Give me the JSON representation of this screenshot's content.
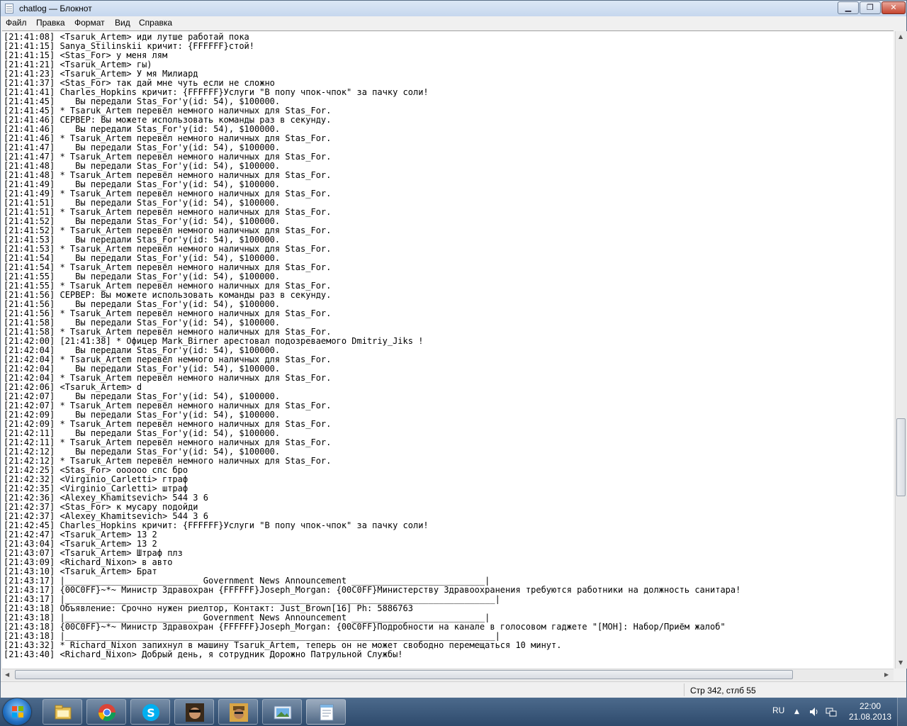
{
  "window": {
    "title": "chatlog — Блокнот",
    "minimize_label": "▁",
    "maximize_label": "❐",
    "close_label": "✕"
  },
  "menu": [
    "Файл",
    "Правка",
    "Формат",
    "Вид",
    "Справка"
  ],
  "lines": [
    "[21:41:08] <Tsaruk_Artem> иди лутше работай пока",
    "[21:41:15] Sanya_Stilinskii кричит: {FFFFFF}стой!",
    "[21:41:15] <Stas_For> у меня лям",
    "[21:41:21] <Tsaruk_Artem> гы)",
    "[21:41:23] <Tsaruk_Artem> У мя Милиард",
    "[21:41:37] <Stas_For> так дай мне чуть если не сложно",
    "[21:41:41] Charles_Hopkins кричит: {FFFFFF}Услуги \"В попу чпок-чпок\" за пачку соли!",
    "[21:41:45]    Вы передали Stas_For'у(id: 54), $100000.",
    "[21:41:45] * Tsaruk_Artem перевёл немного наличных для Stas_For.",
    "[21:41:46] СЕРВЕР: Вы можете использовать команды раз в секунду.",
    "[21:41:46]    Вы передали Stas_For'у(id: 54), $100000.",
    "[21:41:46] * Tsaruk_Artem перевёл немного наличных для Stas_For.",
    "[21:41:47]    Вы передали Stas_For'у(id: 54), $100000.",
    "[21:41:47] * Tsaruk_Artem перевёл немного наличных для Stas_For.",
    "[21:41:48]    Вы передали Stas_For'у(id: 54), $100000.",
    "[21:41:48] * Tsaruk_Artem перевёл немного наличных для Stas_For.",
    "[21:41:49]    Вы передали Stas_For'у(id: 54), $100000.",
    "[21:41:49] * Tsaruk_Artem перевёл немного наличных для Stas_For.",
    "[21:41:51]    Вы передали Stas_For'у(id: 54), $100000.",
    "[21:41:51] * Tsaruk_Artem перевёл немного наличных для Stas_For.",
    "[21:41:52]    Вы передали Stas_For'у(id: 54), $100000.",
    "[21:41:52] * Tsaruk_Artem перевёл немного наличных для Stas_For.",
    "[21:41:53]    Вы передали Stas_For'у(id: 54), $100000.",
    "[21:41:53] * Tsaruk_Artem перевёл немного наличных для Stas_For.",
    "[21:41:54]    Вы передали Stas_For'у(id: 54), $100000.",
    "[21:41:54] * Tsaruk_Artem перевёл немного наличных для Stas_For.",
    "[21:41:55]    Вы передали Stas_For'у(id: 54), $100000.",
    "[21:41:55] * Tsaruk_Artem перевёл немного наличных для Stas_For.",
    "[21:41:56] СЕРВЕР: Вы можете использовать команды раз в секунду.",
    "[21:41:56]    Вы передали Stas_For'у(id: 54), $100000.",
    "[21:41:56] * Tsaruk_Artem перевёл немного наличных для Stas_For.",
    "[21:41:58]    Вы передали Stas_For'у(id: 54), $100000.",
    "[21:41:58] * Tsaruk_Artem перевёл немного наличных для Stas_For.",
    "[21:42:00] [21:41:38] * Офицер Mark_Birner арестовал подозреваемого Dmitriy_Jiks !",
    "[21:42:04]    Вы передали Stas_For'у(id: 54), $100000.",
    "[21:42:04] * Tsaruk_Artem перевёл немного наличных для Stas_For.",
    "[21:42:04]    Вы передали Stas_For'у(id: 54), $100000.",
    "[21:42:04] * Tsaruk_Artem перевёл немного наличных для Stas_For.",
    "[21:42:06] <Tsaruk_Artem> d",
    "[21:42:07]    Вы передали Stas_For'у(id: 54), $100000.",
    "[21:42:07] * Tsaruk_Artem перевёл немного наличных для Stas_For.",
    "[21:42:09]    Вы передали Stas_For'у(id: 54), $100000.",
    "[21:42:09] * Tsaruk_Artem перевёл немного наличных для Stas_For.",
    "[21:42:11]    Вы передали Stas_For'у(id: 54), $100000.",
    "[21:42:11] * Tsaruk_Artem перевёл немного наличных для Stas_For.",
    "[21:42:12]    Вы передали Stas_For'у(id: 54), $100000.",
    "[21:42:12] * Tsaruk_Artem перевёл немного наличных для Stas_For.",
    "[21:42:25] <Stas_For> оооооо спс бро",
    "[21:42:32] <Virginio_Carletti> гтраф",
    "[21:42:35] <Virginio_Carletti> штраф",
    "[21:42:36] <Alexey_Khamitsevich> 544 3 6",
    "[21:42:37] <Stas_For> к мусару подойди",
    "[21:42:37] <Alexey_Khamitsevich> 544 3 6",
    "[21:42:45] Charles_Hopkins кричит: {FFFFFF}Услуги \"В попу чпок-чпок\" за пачку соли!",
    "[21:42:47] <Tsaruk_Artem> 13 2",
    "[21:43:04] <Tsaruk_Artem> 13 2",
    "[21:43:07] <Tsaruk_Artem> Штраф плз",
    "[21:43:09] <Richard_Nixon> в авто",
    "[21:43:10] <Tsaruk_Artem> Брат",
    "[21:43:17] |__________________________ Government News Announcement __________________________|",
    "[21:43:17] {00C0FF}~*~ Министр Здравохран {FFFFFF}Joseph_Morgan: {00C0FF}Министерству Здравоохранения требуются работники на должность санитара!",
    "[21:43:17] |____________________________________________________________________________________|",
    "[21:43:18] Объявление: Срочно нужен риелтор, Контакт: Just_Brown[16] Ph: 5886763",
    "[21:43:18] |__________________________ Government News Announcement __________________________|",
    "[21:43:18] {00C0FF}~*~ Министр Здравохран {FFFFFF}Joseph_Morgan: {00C0FF}Подробности на канале в голосовом гаджете \"[МОН]: Набор/Приём жалоб\"",
    "[21:43:18] |____________________________________________________________________________________|",
    "[21:43:32] * Richard_Nixon запихнул в машину Tsaruk_Artem, теперь он не может свободно перемещаться 10 минут.",
    "[21:43:40] <Richard_Nixon> Добрый день, я сотрудник Дорожно Патрульной Службы!"
  ],
  "status": {
    "position": "Стр 342, стлб 55"
  },
  "taskbar": {
    "apps": [
      "explorer-icon",
      "chrome-icon",
      "skype-icon",
      "game-icon",
      "game-icon",
      "photo-viewer-icon",
      "notepad-icon"
    ],
    "language": "RU",
    "time": "22:00",
    "date": "21.08.2013"
  },
  "colors": {
    "taskbar": "#2e4a6c",
    "close_button": "#c5452f",
    "window_frame": "#dbe7f5"
  }
}
